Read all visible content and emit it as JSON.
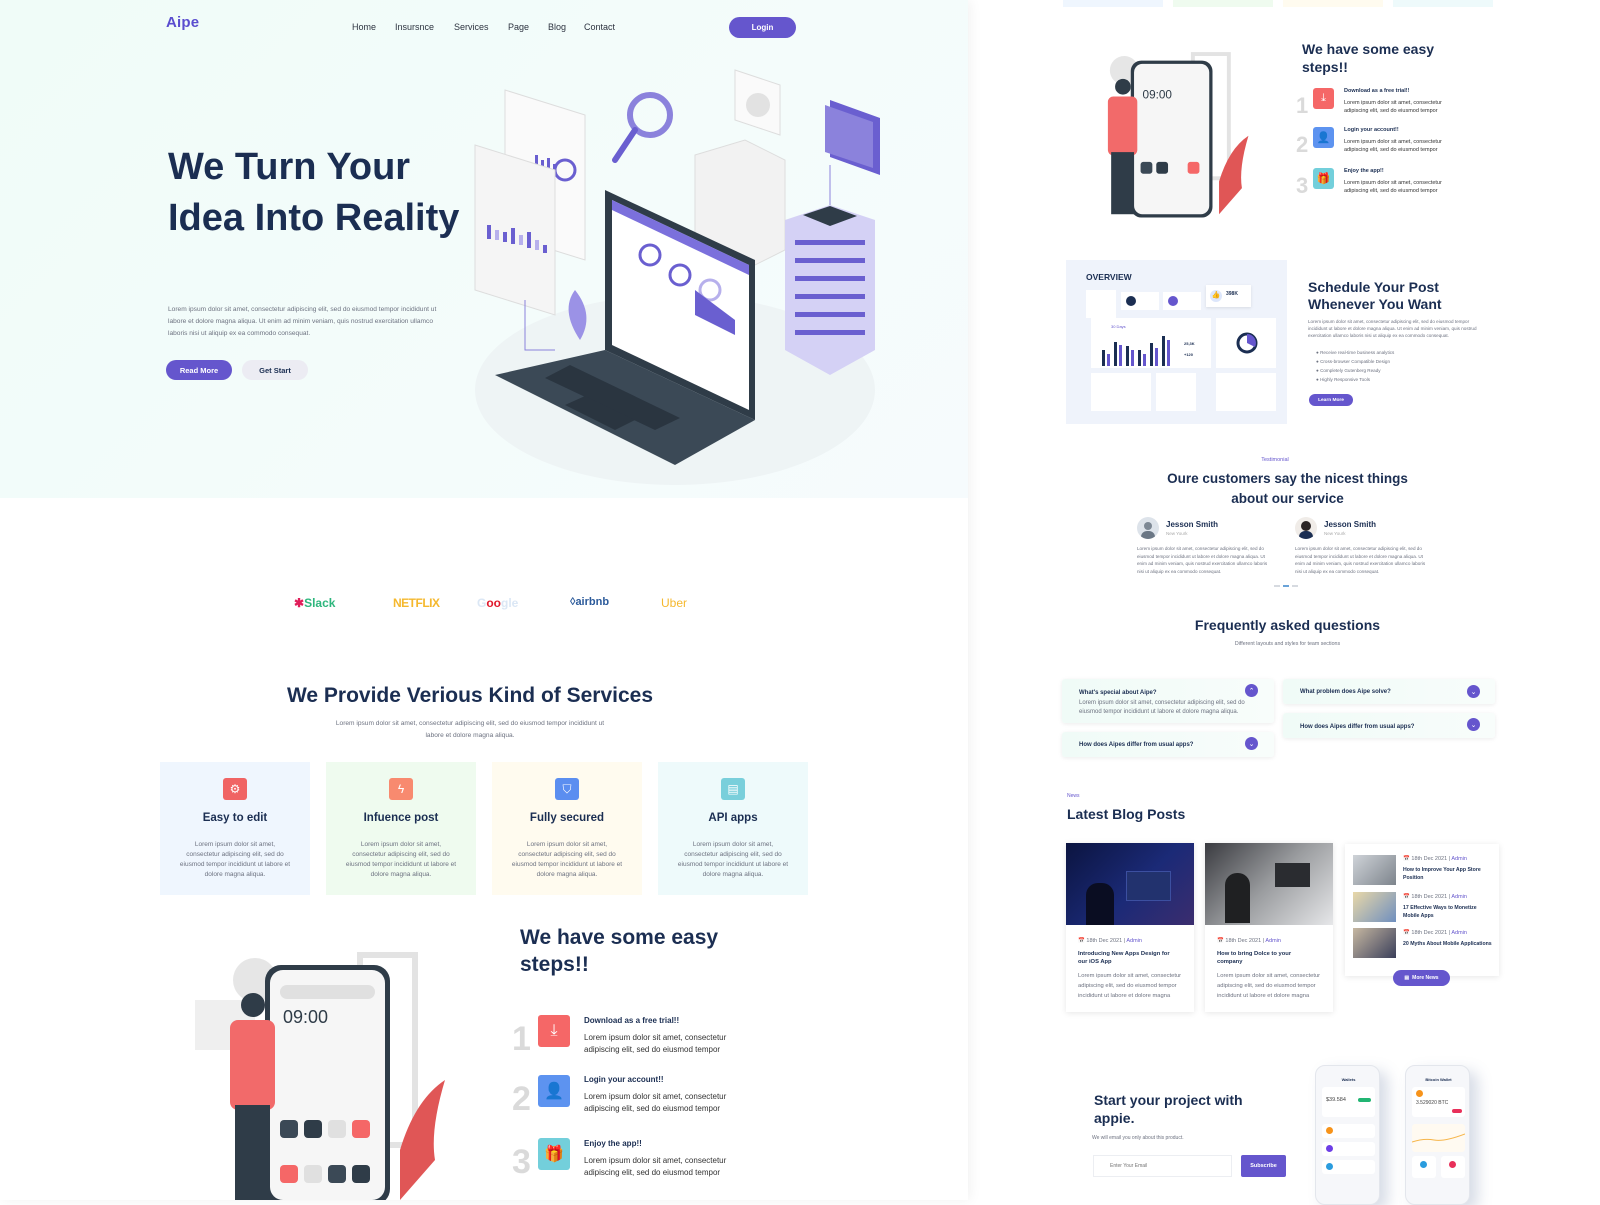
{
  "header": {
    "logo": "Aipe",
    "nav": [
      "Home",
      "Insursnce",
      "Services",
      "Page",
      "Blog",
      "Contact"
    ],
    "login_label": "Login"
  },
  "hero": {
    "title": "We Turn Your Idea Into Reality",
    "description": "Lorem ipsum dolor sit amet, consectetur adipiscing elit, sed do eiusmod tempor incididunt ut labore et dolore magna aliqua. Ut enim ad minim veniam, quis nostrud exercitation ullamco laboris nisi ut aliquip ex ea commodo consequat.",
    "read_more_label": "Read More",
    "get_start_label": "Get Start",
    "illustration": "laptop-server-analytics-illustration"
  },
  "brands": [
    "Slack",
    "NETFLIX",
    "Google",
    "airbnb",
    "Uber"
  ],
  "brand_colors": {
    "slack": "#2eb67d",
    "netflix": "#f5b82e",
    "google": "#dbe7f5",
    "airbnb": "#2b5a9a",
    "uber": "#f5b82e"
  },
  "services": {
    "title": "We Provide Verious Kind of Services",
    "subtitle": "Lorem ipsum dolor sit amet, consectetur adipiscing elit, sed do eiusmod tempor incididunt ut labore et dolore magna aliqua.",
    "items": [
      {
        "title": "Easy to edit",
        "icon": "gear-icon",
        "icon_color": "#f06464",
        "bg": "#eff6fe",
        "desc": "Lorem ipsum dolor sit amet, consectetur adipiscing elit, sed do eiusmod tempor incididunt ut labore et dolore magna aliqua."
      },
      {
        "title": "Infuence post",
        "icon": "lightning-icon",
        "icon_color": "#f88a6f",
        "bg": "#effbef",
        "desc": "Lorem ipsum dolor sit amet, consectetur adipiscing elit, sed do eiusmod tempor incididunt ut labore et dolore magna aliqua."
      },
      {
        "title": "Fully secured",
        "icon": "shield-check-icon",
        "icon_color": "#5b8ef0",
        "bg": "#fffbef",
        "desc": "Lorem ipsum dolor sit amet, consectetur adipiscing elit, sed do eiusmod tempor incididunt ut labore et dolore magna aliqua."
      },
      {
        "title": "API apps",
        "icon": "api-window-icon",
        "icon_color": "#79cfdb",
        "bg": "#eefafb",
        "desc": "Lorem ipsum dolor sit amet, consectetur adipiscing elit, sed do eiusmod tempor incididunt ut labore et dolore magna aliqua."
      }
    ]
  },
  "steps": {
    "title": "We have some easy steps!!",
    "phone_time": "09:00",
    "items": [
      {
        "num": "1",
        "title": "Download as a free trial!!",
        "text": "Lorem ipsum dolor sit amet, consectetur adipiscing elit, sed do eiusmod tempor",
        "icon": "download-icon",
        "color": "#f56767"
      },
      {
        "num": "2",
        "title": "Login your account!!",
        "text": "Lorem ipsum dolor sit amet, consectetur adipiscing elit, sed do eiusmod tempor",
        "icon": "user-icon",
        "color": "#5d93f0"
      },
      {
        "num": "3",
        "title": "Enjoy the app!!",
        "text": "Lorem ipsum dolor sit amet, consectetur adipiscing elit, sed do eiusmod tempor",
        "icon": "gift-icon",
        "color": "#73cfdb"
      }
    ]
  },
  "schedule": {
    "overview_label": "OVERVIEW",
    "stat_likes": "398K",
    "stat_period": "30 Days",
    "stat_value": "25,3K",
    "stat_delta": "+120",
    "title": "Schedule Your Post Whenever You Want",
    "description": "Lorem ipsum dolor sit amet, consectetur adipiscing elit, sed do eiusmod tempor incididunt ut labore et dolore magna aliqua. Ut enim ad minim veniam, quis nostrud exercitation ullamco laboris nisi ut aliquip ex ea commodo consequat.",
    "bullets": [
      "Receive real-time business analytics",
      "Cross-browser Compatible Design",
      "Completely Gutenberg Ready",
      "Highly Responsive Tools"
    ],
    "button_label": "Learn More"
  },
  "testimonial": {
    "eyebrow": "Testimonial",
    "title": "Oure customers say the nicest things about our service",
    "items": [
      {
        "name": "Jesson Smith",
        "location": "New Yourk",
        "text": "Lorem ipsum dolor sit amet, consectetur adipiscing elit, sed do eiusmod tempor incididunt ut labore et dolore magna aliqua. Ut enim ad minim veniam, quis nostrud exercitation ullamco laboris nisi ut aliquip ex ea commodo consequat."
      },
      {
        "name": "Jesson Smith",
        "location": "New Yourk",
        "text": "Lorem ipsum dolor sit amet, consectetur adipiscing elit, sed do eiusmod tempor incididunt ut labore et dolore magna aliqua. Ut enim ad minim veniam, quis nostrud exercitation ullamco laboris nisi ut aliquip ex ea commodo consequat."
      }
    ]
  },
  "faq": {
    "title": "Frequently asked questions",
    "subtitle": "Different layouts and styles for team sections",
    "items": [
      {
        "q": "What's special about Aipe?",
        "a": "Lorem ipsum dolor sit amet, consectetur adipiscing elit, sed do eiusmod tempor incididunt ut labore et dolore magna aliqua.",
        "open": true
      },
      {
        "q": "How does Aipes differ from usual apps?",
        "a": "",
        "open": false
      },
      {
        "q": "What problem does Aipe solve?",
        "a": "",
        "open": false
      },
      {
        "q": "How does Aipes differ from usual apps?",
        "a": "",
        "open": false
      }
    ]
  },
  "blog": {
    "eyebrow": "News",
    "title": "Latest Blog Posts",
    "featured": [
      {
        "date": "18th Dec 2021",
        "author": "Admin",
        "title": "Introducing New Apps Design for our iOS App",
        "desc": "Lorem ipsum dolor sit amet, consectetur adipiscing elit, sed do eiusmod tempor incididunt ut labore et dolore magna"
      },
      {
        "date": "18th Dec 2021",
        "author": "Admin",
        "title": "How to bring Dolce to your company",
        "desc": "Lorem ipsum dolor sit amet, consectetur adipiscing elit, sed do eiusmod tempor incididunt ut labore et dolore magna"
      }
    ],
    "list": [
      {
        "date": "18th Dec 2021",
        "author": "Admin",
        "title": "How to Improve Your App Store Position"
      },
      {
        "date": "18th Dec 2021",
        "author": "Admin",
        "title": "17 Effective Ways to Monetize Mobile Apps"
      },
      {
        "date": "18th Dec 2021",
        "author": "Admin",
        "title": "20 Myths About Mobile Applications"
      }
    ],
    "more_label": "More News"
  },
  "cta": {
    "title": "Start your project with appie.",
    "subtitle": "We will email you only about this product.",
    "email_placeholder": "Enter Your Email",
    "subscribe_label": "Subscribe",
    "phone1": {
      "title": "Wallets",
      "balance": "$39.584"
    },
    "phone2": {
      "title": "Bitcoin Wallet",
      "balance": "3.529020 BTC"
    }
  }
}
